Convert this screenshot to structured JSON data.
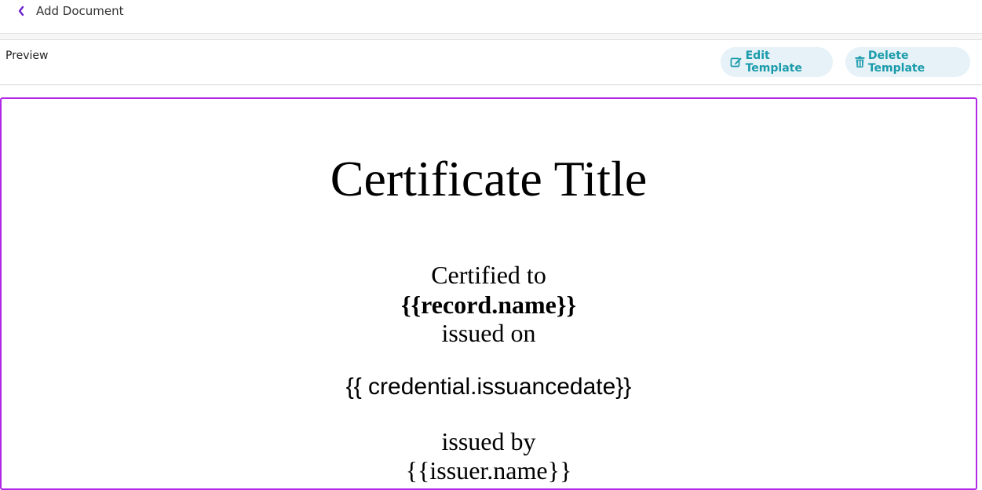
{
  "header": {
    "back_icon": "chevron-left-icon",
    "title": "Add Document"
  },
  "toolbar": {
    "preview_label": "Preview",
    "edit_label": "Edit Template",
    "edit_icon": "edit-icon",
    "delete_label": "Delete Template",
    "delete_icon": "trash-icon"
  },
  "certificate": {
    "title": "Certificate Title",
    "certified_to": "Certified to",
    "record_name": "{{record.name}}",
    "issued_on": "issued on",
    "issuance_date": "{{ credential.issuancedate}}",
    "issued_by": "issued by",
    "issuer_name": "{{issuer.name}}"
  },
  "colors": {
    "accent_purple": "#b129e8",
    "back_icon": "#6a1fd1",
    "button_text": "#1a9bab",
    "button_bg": "#e6f2f7"
  }
}
